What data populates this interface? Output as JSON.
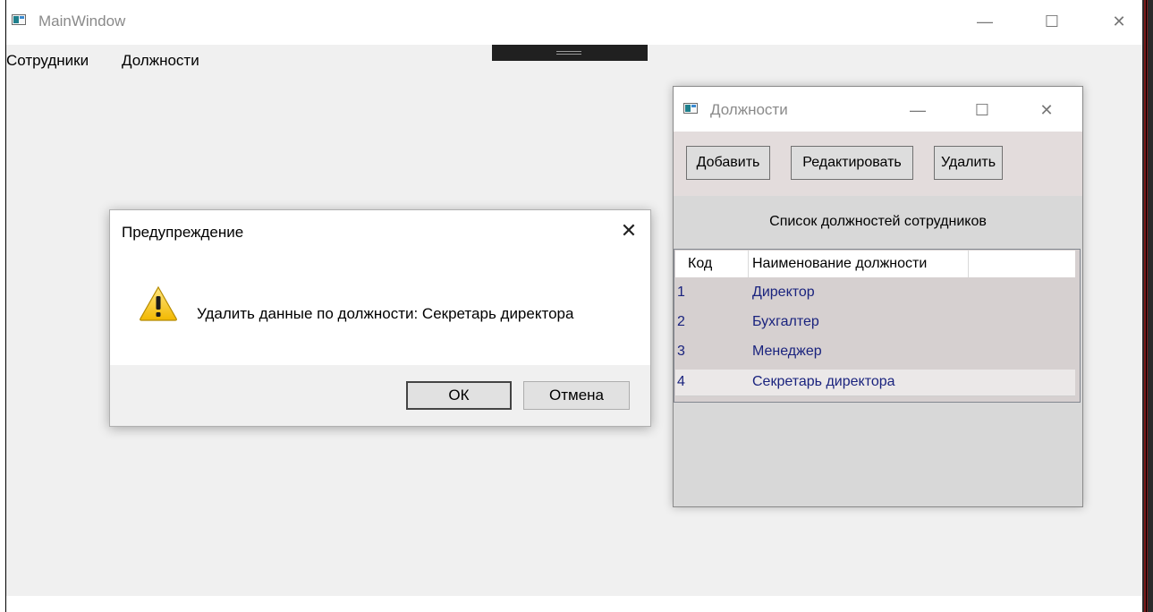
{
  "main_window": {
    "title": "MainWindow",
    "menu": [
      "Сотрудники",
      "Должности"
    ],
    "controls": {
      "minimize": "—",
      "maximize": "☐",
      "close": "✕"
    }
  },
  "positions_window": {
    "title": "Должности",
    "controls": {
      "minimize": "—",
      "maximize": "☐",
      "close": "✕"
    },
    "toolbar": {
      "add": "Добавить",
      "edit": "Редактировать",
      "delete": "Удалить"
    },
    "caption": "Список должностей сотрудников",
    "grid": {
      "columns": [
        "Код",
        "Наименование должности"
      ],
      "rows": [
        {
          "id": "1",
          "name": "Директор"
        },
        {
          "id": "2",
          "name": "Бухгалтер"
        },
        {
          "id": "3",
          "name": "Менеджер"
        },
        {
          "id": "4",
          "name": "Секретарь директора"
        }
      ],
      "selected_row": 4
    }
  },
  "message_box": {
    "title": "Предупреждение",
    "close": "✕",
    "icon": "warning-icon",
    "text": "Удалить данные по должности: Секретарь директора",
    "buttons": {
      "ok": "ОК",
      "cancel": "Отмена"
    }
  },
  "colors": {
    "row_text": "#1a237e",
    "toolbar_bg": "#e3dcdc",
    "grid_bg": "#d6d0d0",
    "window_bg": "#f0f0f0"
  }
}
